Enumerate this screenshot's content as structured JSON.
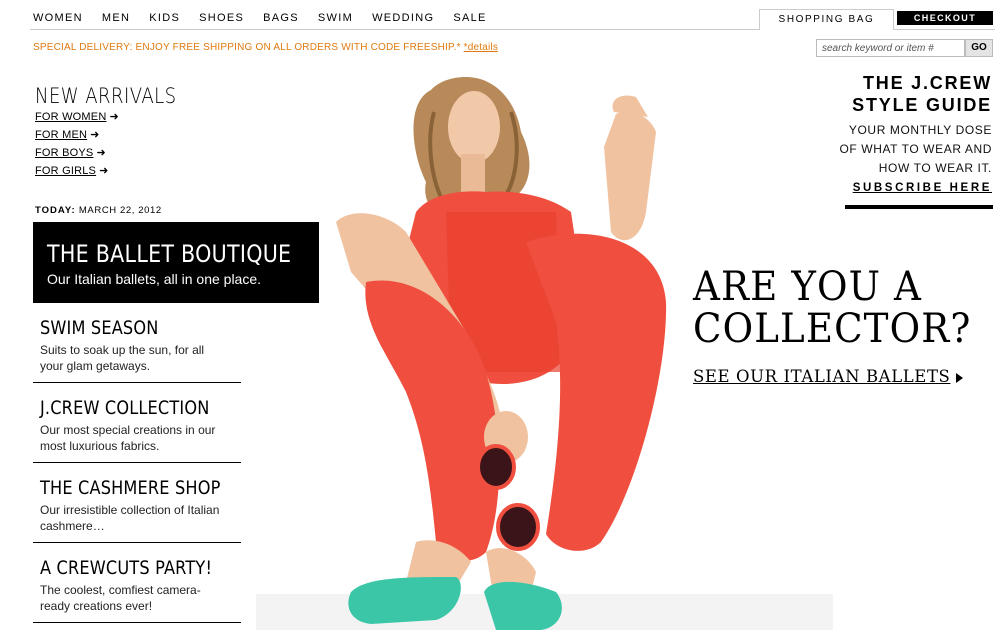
{
  "nav": {
    "items": [
      "WOMEN",
      "MEN",
      "KIDS",
      "SHOES",
      "BAGS",
      "SWIM",
      "WEDDING",
      "SALE"
    ],
    "shopping_bag": "SHOPPING BAG",
    "checkout": "CHECKOUT"
  },
  "promo": {
    "text": "SPECIAL DELIVERY: ENJOY FREE SHIPPING ON ALL ORDERS WITH CODE FREESHIP.*",
    "link": "*details"
  },
  "search": {
    "placeholder": "search keyword or item #",
    "go": "GO"
  },
  "new_arrivals": {
    "title": "NEW ARRIVALS",
    "links": [
      "FOR WOMEN",
      "FOR MEN",
      "FOR BOYS",
      "FOR GIRLS"
    ]
  },
  "today": {
    "label": "TODAY:",
    "date": "MARCH  22, 2012"
  },
  "feature": {
    "title": "THE BALLET BOUTIQUE",
    "subtitle": "Our Italian ballets, all in one place."
  },
  "promo_items": [
    {
      "title": "SWIM SEASON",
      "desc": "Suits to soak up the sun, for all your glam getaways."
    },
    {
      "title": "J.CREW COLLECTION",
      "desc": "Our most special creations in our most luxurious fabrics."
    },
    {
      "title": "THE CASHMERE SHOP",
      "desc": "Our irresistible collection of Italian cashmere…"
    },
    {
      "title": "A CREWCUTS PARTY!",
      "desc": "The coolest, comfiest camera-ready creations ever!"
    }
  ],
  "style_guide": {
    "title_line1": "THE J.CREW",
    "title_line2": "STYLE GUIDE",
    "sub_line1": "YOUR MONTHLY DOSE",
    "sub_line2": "OF WHAT TO WEAR AND",
    "sub_line3": "HOW TO WEAR IT.",
    "link": "SUBSCRIBE HERE"
  },
  "hero": {
    "headline_line1": "ARE YOU A",
    "headline_line2": "COLLECTOR?",
    "cta": "SEE OUR ITALIAN BALLETS"
  },
  "colors": {
    "promo_orange": "#e07a10",
    "outfit_coral": "#f04f3f",
    "shoe_teal": "#3cc6a8"
  }
}
